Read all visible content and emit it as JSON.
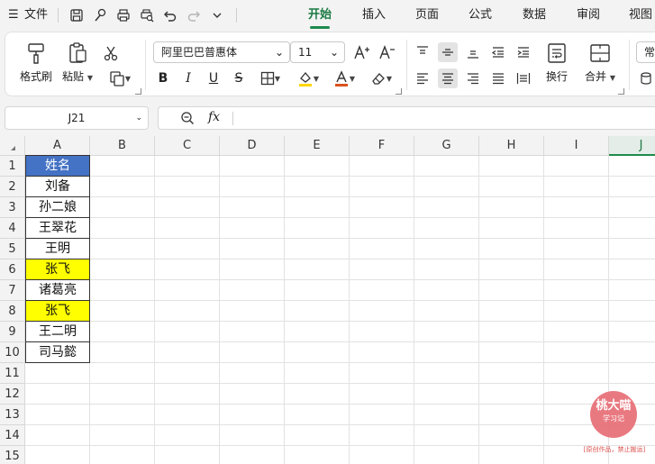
{
  "menubar": {
    "file_label": "文件",
    "tabs": [
      {
        "label": "开始",
        "active": true
      },
      {
        "label": "插入",
        "active": false
      },
      {
        "label": "页面",
        "active": false
      },
      {
        "label": "公式",
        "active": false
      },
      {
        "label": "数据",
        "active": false
      },
      {
        "label": "审阅",
        "active": false
      },
      {
        "label": "视图",
        "active": false
      }
    ],
    "accent_color": "#1f8a4c"
  },
  "ribbon": {
    "format_painter_label": "格式刷",
    "paste_label": "粘贴",
    "font_name": "阿里巴巴普惠体",
    "font_size": "11",
    "wrap_label": "换行",
    "merge_label": "合并",
    "number_format_partial": "常"
  },
  "formula_bar": {
    "cell_ref": "J21",
    "fx_label": "fx",
    "value": ""
  },
  "sheet": {
    "columns": [
      "A",
      "B",
      "C",
      "D",
      "E",
      "F",
      "G",
      "H",
      "I",
      "J"
    ],
    "selected_column": "J",
    "rows": [
      "1",
      "2",
      "3",
      "4",
      "5",
      "6",
      "7",
      "8",
      "9",
      "10",
      "11",
      "12",
      "13",
      "14",
      "15"
    ],
    "cells_a": [
      {
        "text": "姓名",
        "bg": "#4472c4",
        "color": "#ffffff"
      },
      {
        "text": "刘备",
        "bg": "#ffffff",
        "color": "#111111"
      },
      {
        "text": "孙二娘",
        "bg": "#ffffff",
        "color": "#111111"
      },
      {
        "text": "王翠花",
        "bg": "#ffffff",
        "color": "#111111"
      },
      {
        "text": "王明",
        "bg": "#ffffff",
        "color": "#111111"
      },
      {
        "text": "张飞",
        "bg": "#ffff00",
        "color": "#111111"
      },
      {
        "text": "诸葛亮",
        "bg": "#ffffff",
        "color": "#111111"
      },
      {
        "text": "张飞",
        "bg": "#ffff00",
        "color": "#111111"
      },
      {
        "text": "王二明",
        "bg": "#ffffff",
        "color": "#111111"
      },
      {
        "text": "司马懿",
        "bg": "#ffffff",
        "color": "#111111"
      }
    ]
  },
  "watermark": {
    "title": "桃大喵",
    "subtitle": "学习记",
    "note": "[原创作品，禁止搬运]"
  }
}
